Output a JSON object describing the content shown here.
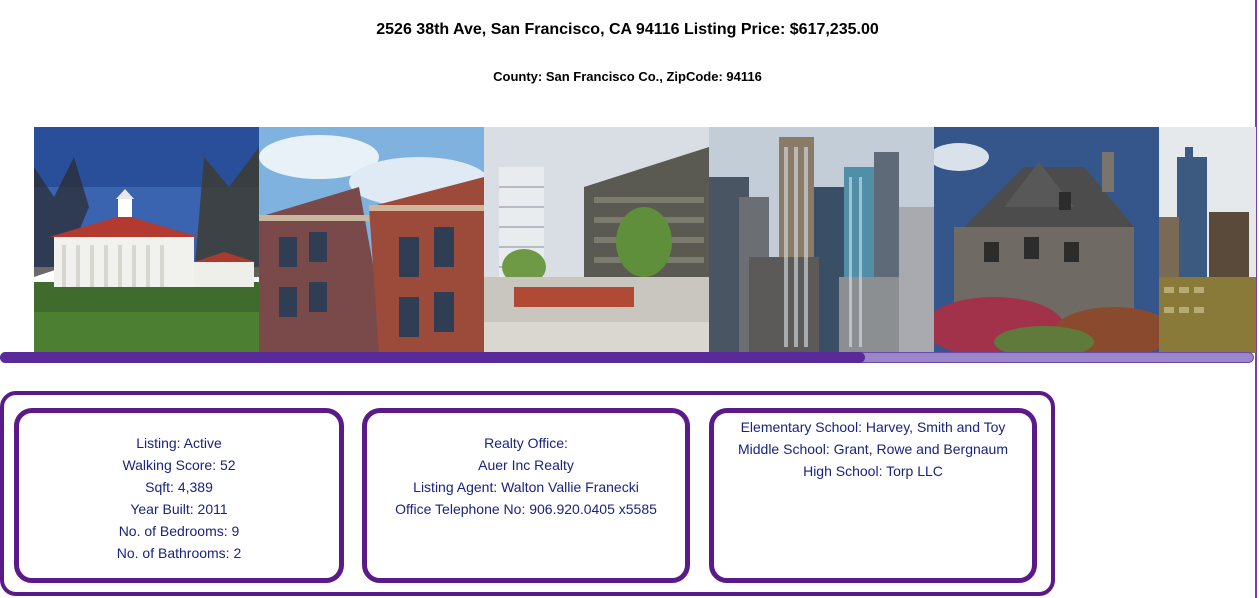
{
  "header": {
    "title": "2526 38th Ave, San Francisco, CA 94116 Listing Price: $617,235.00",
    "subtitle": "County: San Francisco Co., ZipCode: 94116"
  },
  "gallery": {
    "photos": [
      {
        "icon": "colonial-mansion-photo"
      },
      {
        "icon": "victorian-brick-building-photo"
      },
      {
        "icon": "modern-apartments-plaza-photo"
      },
      {
        "icon": "city-skyline-photo"
      },
      {
        "icon": "stone-house-photo"
      },
      {
        "icon": "skyscraper-photo"
      }
    ],
    "scroll_position": 0.69
  },
  "listing": {
    "status": "Listing: Active",
    "walking_score": "Walking Score: 52",
    "sqft": "Sqft: 4,389",
    "year_built": "Year Built: 2011",
    "bedrooms": "No. of Bedrooms: 9",
    "bathrooms": "No. of Bathrooms: 2"
  },
  "agent": {
    "office_label": "Realty Office:",
    "office_name": "Auer Inc Realty",
    "listing_agent": "Listing Agent: Walton Vallie Franecki",
    "phone": "Office Telephone No: 906.920.0405 x5585"
  },
  "schools": {
    "elementary": "Elementary School: Harvey, Smith and Toy",
    "middle": "Middle School: Grant, Rowe and Bergnaum",
    "high": "High School: Torp LLC"
  },
  "colors": {
    "accent_purple": "#5b1a8a",
    "text_navy": "#1a237e",
    "scroll_thumb": "#5a2a9a"
  }
}
